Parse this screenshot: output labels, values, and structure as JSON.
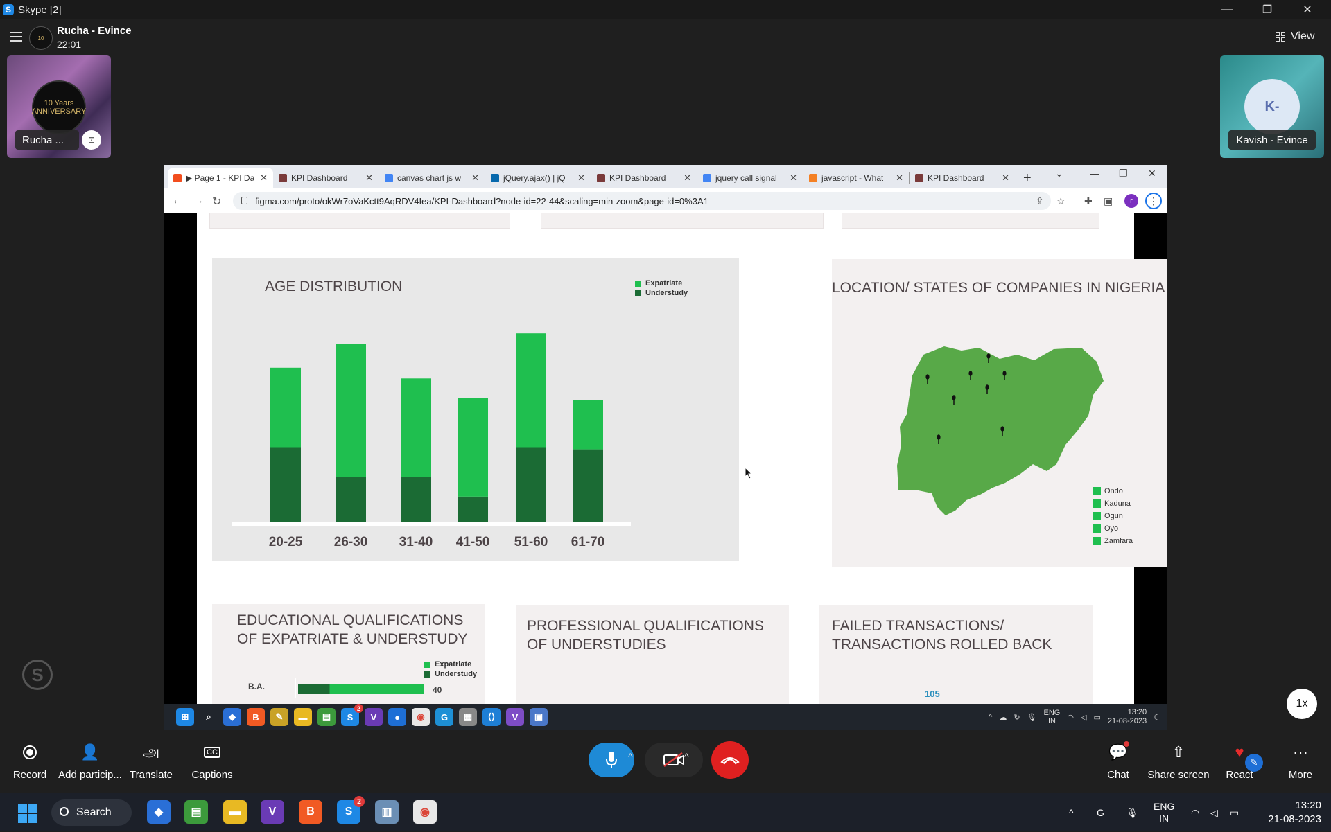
{
  "window": {
    "title": "Skype [2]",
    "minimize": "—",
    "restore": "❐",
    "close": "✕"
  },
  "call": {
    "contact_name": "Rucha - Evince",
    "duration": "22:01",
    "view_label": "View"
  },
  "participants": {
    "left": {
      "name": "Rucha ...",
      "avatar_text": "10 Years ANNIVERSARY"
    },
    "right": {
      "name": "Kavish - Evince",
      "initials": "K-"
    }
  },
  "browser": {
    "tabs": [
      {
        "label": "▶ Page 1 - KPI Da",
        "fav_color": "#f24e1e",
        "active": true
      },
      {
        "label": "KPI Dashboard",
        "fav_color": "#7a3a3a"
      },
      {
        "label": "canvas chart js w",
        "fav_color": "#4285f4"
      },
      {
        "label": "jQuery.ajax() | jQ",
        "fav_color": "#0769ad"
      },
      {
        "label": "KPI Dashboard",
        "fav_color": "#7a3a3a"
      },
      {
        "label": "jquery call signal",
        "fav_color": "#4285f4"
      },
      {
        "label": "javascript - What",
        "fav_color": "#f48024"
      },
      {
        "label": "KPI Dashboard",
        "fav_color": "#7a3a3a"
      }
    ],
    "url": "figma.com/proto/okWr7oVaKctt9AqRDV4Iea/KPI-Dashboard?node-id=22-44&scaling=min-zoom&page-id=0%3A1",
    "profile_initial": "r"
  },
  "dashboard": {
    "age_title": "AGE DISTRIBUTION",
    "loc_title": "LOCATION/ STATES OF COMPANIES IN NIGERIA",
    "edu_title": "EDUCATIONAL QUALIFICATIONS OF EXPATRIATE & UNDERSTUDY",
    "prof_title": "PROFESSIONAL QUALIFICATIONS OF UNDERSTUDIES",
    "failed_title": "FAILED TRANSACTIONS/ TRANSACTIONS ROLLED BACK",
    "failed_value": "105",
    "edu_legend": [
      "Expatriate",
      "Understudy"
    ],
    "edu_row_label": "B.A.",
    "edu_row_value": "40",
    "map_legend": [
      "Ondo",
      "Kaduna",
      "Ogun",
      "Oyo",
      "Zamfara"
    ],
    "colors": {
      "expatriate": "#1fbf4f",
      "understudy": "#1b6b34",
      "map": "#58a948"
    }
  },
  "chart_data": [
    {
      "type": "bar",
      "stacked": true,
      "title": "AGE DISTRIBUTION",
      "categories": [
        "20-25",
        "26-30",
        "31-40",
        "41-50",
        "51-60",
        "61-70"
      ],
      "series": [
        {
          "name": "Understudy",
          "values": [
            35,
            21,
            21,
            12,
            35,
            34
          ]
        },
        {
          "name": "Expatriate",
          "values": [
            37,
            62,
            46,
            46,
            53,
            23
          ]
        }
      ],
      "legend": "top-right",
      "ylim": [
        0,
        90
      ]
    },
    {
      "type": "bar",
      "orientation": "horizontal",
      "stacked": true,
      "categories": [
        "B.A."
      ],
      "series": [
        {
          "name": "Understudy",
          "values": [
            10
          ]
        },
        {
          "name": "Expatriate",
          "values": [
            30
          ]
        }
      ],
      "data_labels": [
        "40"
      ]
    }
  ],
  "controls": {
    "record": "Record",
    "add_participants": "Add particip...",
    "translate": "Translate",
    "captions": "Captions",
    "chat": "Chat",
    "share_screen": "Share screen",
    "react": "React",
    "more": "More",
    "speed": "1x"
  },
  "inner_taskbar": {
    "lang": "ENG",
    "region": "IN",
    "time": "13:20",
    "date": "21-08-2023",
    "skype_badge": "2"
  },
  "taskbar": {
    "search_label": "Search",
    "lang": "ENG",
    "region": "IN",
    "time": "13:20",
    "date": "21-08-2023",
    "skype_badge": "2"
  }
}
